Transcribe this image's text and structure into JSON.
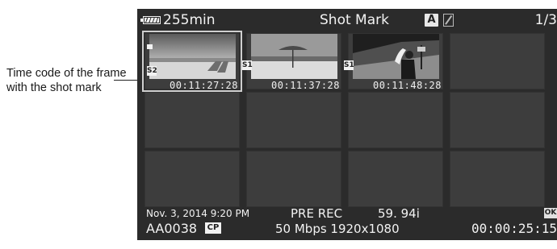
{
  "callout": {
    "text": "Time code of the frame with the shot mark"
  },
  "topbar": {
    "remaining": "255min",
    "title": "Shot Mark",
    "mode": "A",
    "page": "1/3"
  },
  "thumbnails": [
    {
      "timecode": "00:11:27:28",
      "mark": "S2",
      "selected": true
    },
    {
      "timecode": "00:11:37:28",
      "mark": "S1",
      "selected": false
    },
    {
      "timecode": "00:11:48:28",
      "mark": "S1",
      "selected": false
    }
  ],
  "bottom": {
    "date": "Nov. 3, 2014  9:20 PM",
    "clip": "AA0038",
    "cp": "CP",
    "prerec": "PRE REC",
    "frame_rate": "59. 94i",
    "format": "50 Mbps 1920x1080",
    "ok": "OK",
    "total_time": "00:00:25:15"
  }
}
